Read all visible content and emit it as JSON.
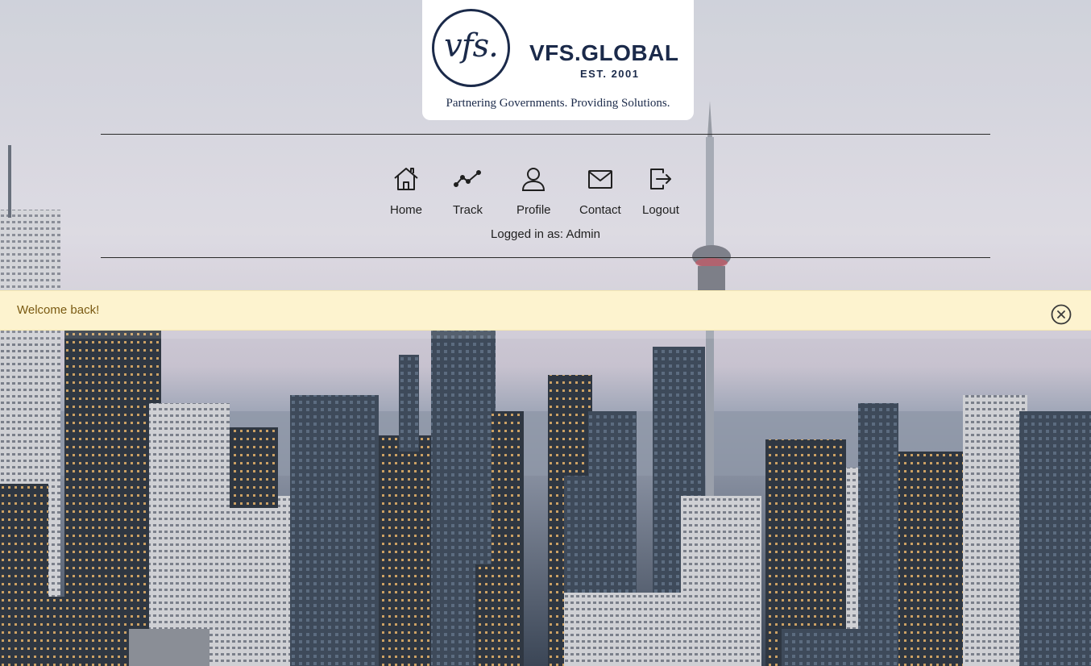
{
  "header": {
    "logo": {
      "mark": "vfs.",
      "brand": "VFS.GLOBAL",
      "established": "EST. 2001",
      "tagline": "Partnering Governments. Providing Solutions."
    }
  },
  "nav": {
    "items": [
      {
        "label": "Home",
        "icon": "home-icon"
      },
      {
        "label": "Track",
        "icon": "track-icon"
      },
      {
        "label": "Profile",
        "icon": "user-icon"
      },
      {
        "label": "Contact",
        "icon": "mail-icon"
      },
      {
        "label": "Logout",
        "icon": "logout-icon"
      }
    ],
    "logged_in": "Logged in as: Admin"
  },
  "alert": {
    "message": "Welcome back!",
    "close_icon": "close-circle-icon"
  },
  "colors": {
    "brand_navy": "#1b2a4a",
    "alert_bg": "#fdf3cf",
    "alert_text": "#7a5a12"
  }
}
